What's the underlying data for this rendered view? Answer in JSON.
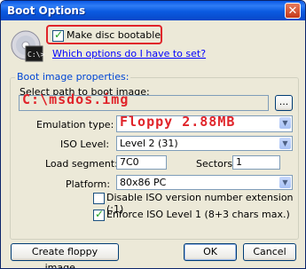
{
  "window": {
    "title": "Boot Options"
  },
  "make_bootable": {
    "label": "Make disc bootable",
    "checked": true
  },
  "help_link": "Which options do I have to set?",
  "group": {
    "title": "Boot image properties:",
    "path_label": "Select path to boot image:",
    "path_value": "C:\\msdos.img",
    "browse_label": "...",
    "emulation_label": "Emulation type:",
    "emulation_value": "Floppy 2.88MB",
    "iso_label": "ISO Level:",
    "iso_value": "Level 2 (31)",
    "load_segment_label": "Load segment:",
    "load_segment_value": "7C0",
    "sectors_label": "Sectors:",
    "sectors_value": "1",
    "platform_label": "Platform:",
    "platform_value": "80x86 PC",
    "disable_iso_label": "Disable ISO version number extension (;1)",
    "disable_iso_checked": false,
    "enforce_iso_label": "Enforce ISO Level 1 (8+3 chars max.)",
    "enforce_iso_checked": true
  },
  "buttons": {
    "create_floppy": "Create floppy image...",
    "ok": "OK",
    "cancel": "Cancel"
  },
  "icon": {
    "name": "cd-command-prompt-icon",
    "prompt_text": "C:\\>"
  },
  "colors": {
    "title_bar": "#0a5ae0",
    "highlight": "#e0242a",
    "link": "#0000ff"
  }
}
